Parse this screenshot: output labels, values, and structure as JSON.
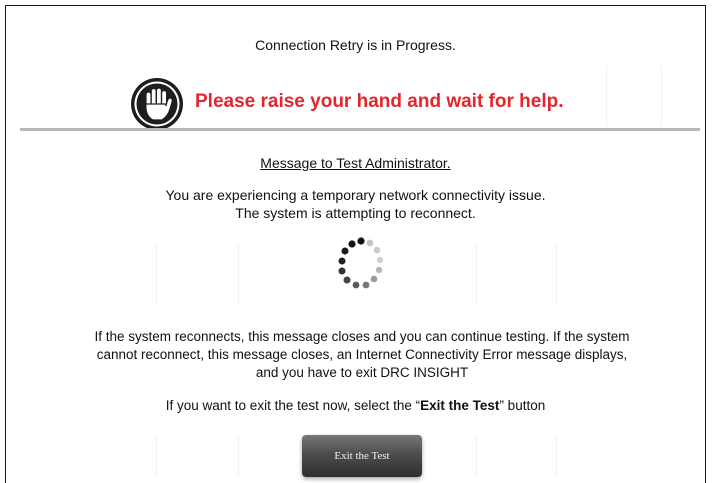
{
  "dialog": {
    "status_title": "Connection Retry is in Progress.",
    "alert_text": "Please raise your hand and wait for help.",
    "alert_icon": "raised-hand-icon",
    "alert_color": "#e3262d",
    "admin_heading": "Message to Test Administrator.",
    "issue_line_1": "You are experiencing a temporary network connectivity issue.",
    "issue_line_2": "The system is attempting to reconnect.",
    "spinner_icon": "loading-spinner-icon",
    "info_line_1": "If the system reconnects, this message closes and you can continue testing. If the system",
    "info_line_2": "cannot reconnect, this message closes, an Internet Connectivity Error message displays,",
    "info_line_3": "and you have to exit DRC INSIGHT",
    "exit_instruction_prefix": "If you want to exit the test now, select the “",
    "exit_instruction_bold": "Exit the Test",
    "exit_instruction_suffix": "” button",
    "exit_button_label": "Exit the Test"
  }
}
